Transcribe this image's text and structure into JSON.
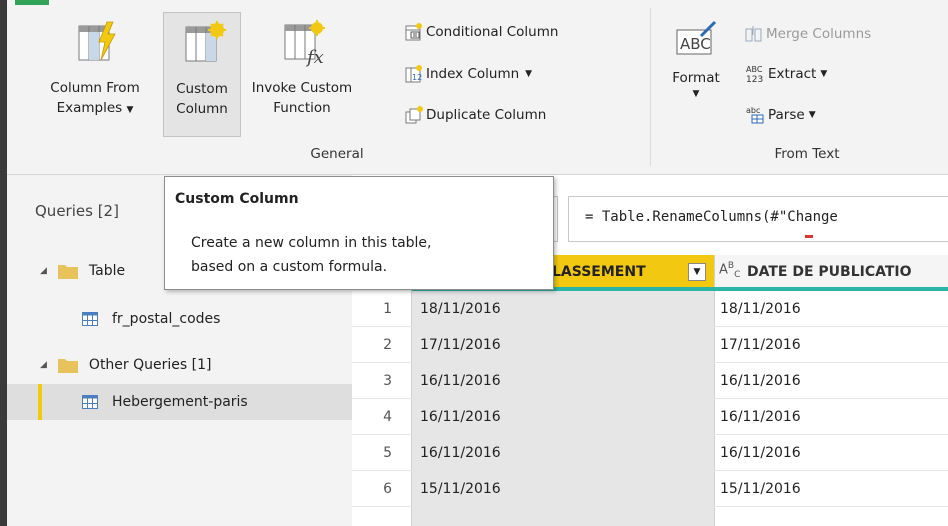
{
  "ribbon": {
    "column_from_examples": {
      "line1": "Column From",
      "line2": "Examples"
    },
    "custom_column": {
      "line1": "Custom",
      "line2": "Column"
    },
    "invoke_custom_function": {
      "line1": "Invoke Custom",
      "line2": "Function"
    },
    "conditional_column": "Conditional Column",
    "index_column": "Index Column",
    "duplicate_column": "Duplicate Column",
    "group_general": "General",
    "format": "Format",
    "merge_columns": "Merge Columns",
    "extract": "Extract",
    "parse": "Parse",
    "group_from_text": "From Text",
    "format_icon_text": "ABC",
    "abc_123_top": "ABC",
    "abc_123_bottom": "123",
    "parse_icon_text": "abc"
  },
  "queries": {
    "header": "Queries [2]",
    "groups": [
      {
        "name": "Table",
        "items": [
          "fr_postal_codes"
        ]
      },
      {
        "name": "Other Queries [1]",
        "items": [
          "Hebergement-paris"
        ]
      }
    ]
  },
  "formula_bar": {
    "text": "= Table.RenameColumns(#\"Change"
  },
  "tooltip": {
    "title": "Custom Column",
    "line1": "Create a new column in this table,",
    "line2": "based on a custom formula."
  },
  "grid": {
    "columns": [
      {
        "name": "LASSEMENT",
        "type_icon": "calendar-icon"
      },
      {
        "name": "DATE DE PUBLICATIO",
        "type_icon": "abc-type-icon"
      }
    ],
    "type_icon_text": {
      "a": "A",
      "b": "B",
      "c": "C"
    },
    "rows": [
      {
        "n": "1",
        "c1": "18/11/2016",
        "c2": "18/11/2016"
      },
      {
        "n": "2",
        "c1": "17/11/2016",
        "c2": "17/11/2016"
      },
      {
        "n": "3",
        "c1": "16/11/2016",
        "c2": "16/11/2016"
      },
      {
        "n": "4",
        "c1": "16/11/2016",
        "c2": "16/11/2016"
      },
      {
        "n": "5",
        "c1": "16/11/2016",
        "c2": "16/11/2016"
      },
      {
        "n": "6",
        "c1": "15/11/2016",
        "c2": "15/11/2016"
      }
    ]
  },
  "colors": {
    "accent_yellow": "#f2c811",
    "teal": "#2bb5a7",
    "folder": "#e8c25a"
  }
}
